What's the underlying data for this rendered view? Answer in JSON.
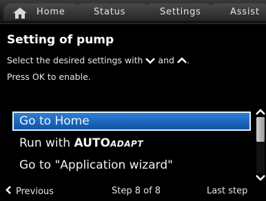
{
  "tabs": [
    {
      "label": "Home",
      "icon": "home-icon"
    },
    {
      "label": "Status"
    },
    {
      "label": "Settings"
    },
    {
      "label": "Assist"
    }
  ],
  "header": {
    "title": "Setting of pump",
    "instruction_line1_prefix": "Select the desired settings with",
    "instruction_line1_mid": "and",
    "instruction_line1_suffix": ".",
    "instruction_line2": "Press OK to enable."
  },
  "list": {
    "items": [
      {
        "label": "Go to Home",
        "selected": true
      },
      {
        "label_prefix": "Run with ",
        "brand_main": "AUTO",
        "brand_sub": "ADAPT",
        "selected": false
      },
      {
        "label": "Go to \"Application wizard\"",
        "selected": false
      }
    ]
  },
  "footer": {
    "previous_label": "Previous",
    "step_label": "Step 8 of 8",
    "last_step_label": "Last step"
  },
  "colors": {
    "selection": "#1a66bd",
    "background": "#000000"
  }
}
